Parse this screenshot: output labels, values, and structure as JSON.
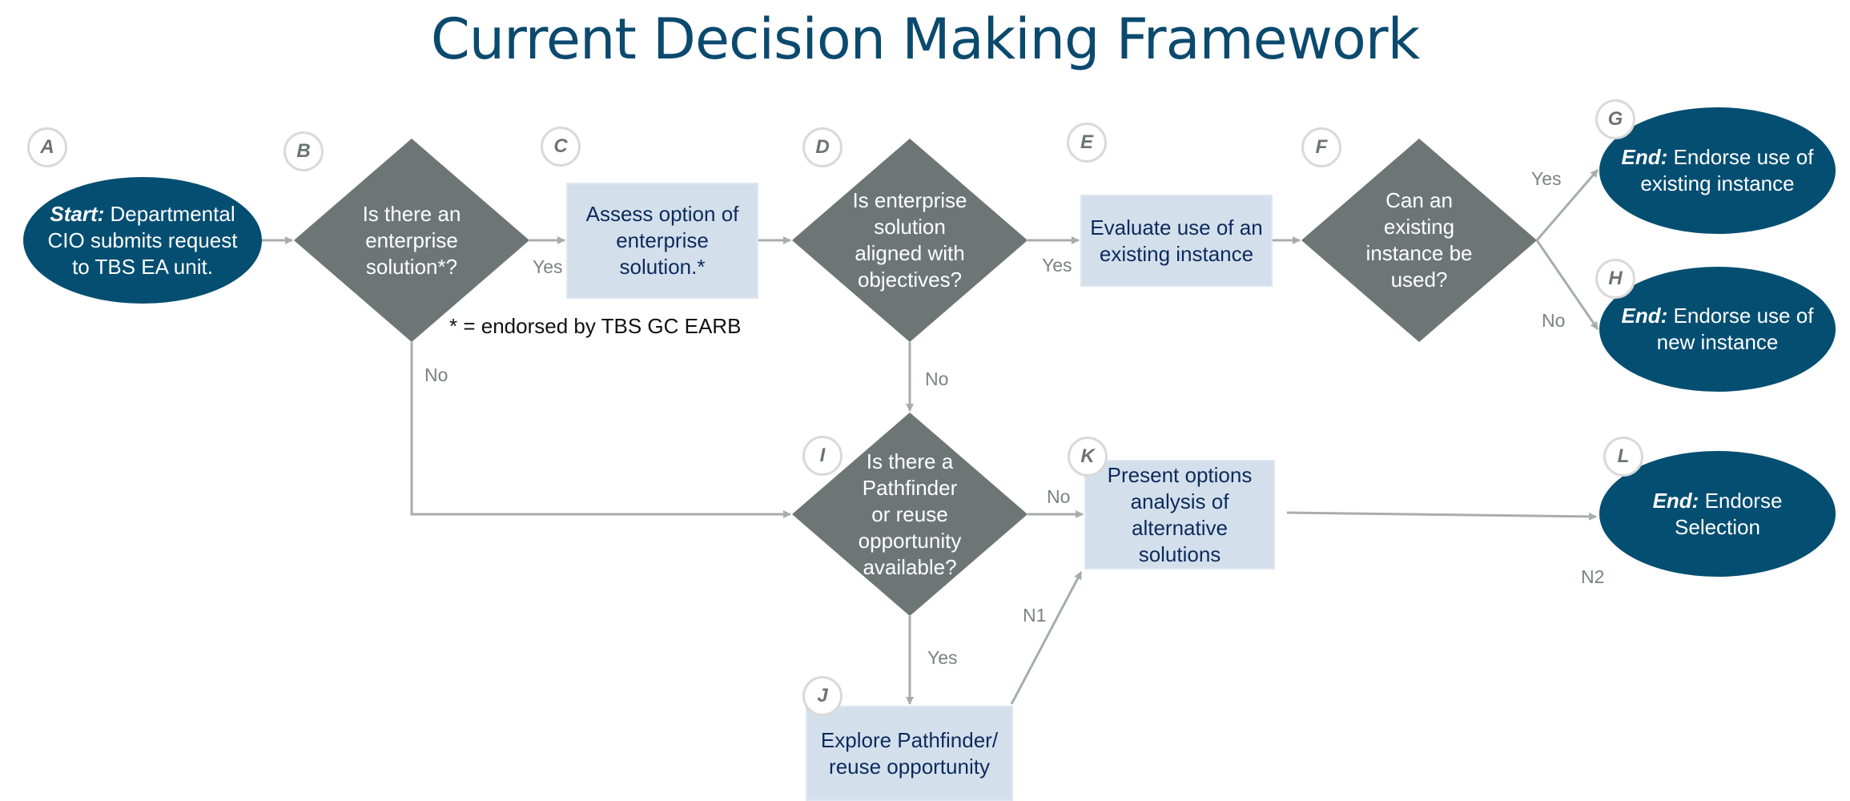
{
  "title": "Current Decision Making Framework",
  "colors": {
    "title": "#0b4a6e",
    "terminal_fill": "#044e72",
    "decision_fill": "#6e7675",
    "process_fill": "#d3e0ec",
    "process_text": "#0d2a5c",
    "connector": "#a8adac"
  },
  "footnote": "* = endorsed by TBS GC EARB",
  "nodes": {
    "A": {
      "badge": "A",
      "type": "terminal",
      "prefix": "Start:",
      "text": " Departmental CIO submits request to TBS EA unit."
    },
    "B": {
      "badge": "B",
      "type": "decision",
      "text": "Is there an enterprise solution*?"
    },
    "C": {
      "badge": "C",
      "type": "process",
      "text": "Assess option of enterprise solution.*"
    },
    "D": {
      "badge": "D",
      "type": "decision",
      "text": "Is enterprise solution aligned with objectives?"
    },
    "E": {
      "badge": "E",
      "type": "process",
      "text": "Evaluate use of an existing instance"
    },
    "F": {
      "badge": "F",
      "type": "decision",
      "text": "Can an existing instance be used?"
    },
    "G": {
      "badge": "G",
      "type": "terminal",
      "prefix": "End:",
      "text": " Endorse use of existing instance"
    },
    "H": {
      "badge": "H",
      "type": "terminal",
      "prefix": "End:",
      "text": " Endorse use of new instance"
    },
    "I": {
      "badge": "I",
      "type": "decision",
      "text": "Is there a Pathfinder or reuse opportunity available?"
    },
    "J": {
      "badge": "J",
      "type": "process",
      "text": "Explore Pathfinder/ reuse opportunity"
    },
    "K": {
      "badge": "K",
      "type": "process",
      "text": "Present options analysis of alternative solutions"
    },
    "L": {
      "badge": "L",
      "type": "terminal",
      "prefix": "End:",
      "text": " Endorse Selection"
    }
  },
  "edges": {
    "B_C": "Yes",
    "D_E": "Yes",
    "F_G": "Yes",
    "F_H": "No",
    "B_I": "No",
    "D_I": "No",
    "I_K": "No",
    "I_J": "Yes",
    "J_K": "N1",
    "K_L": "N2"
  }
}
